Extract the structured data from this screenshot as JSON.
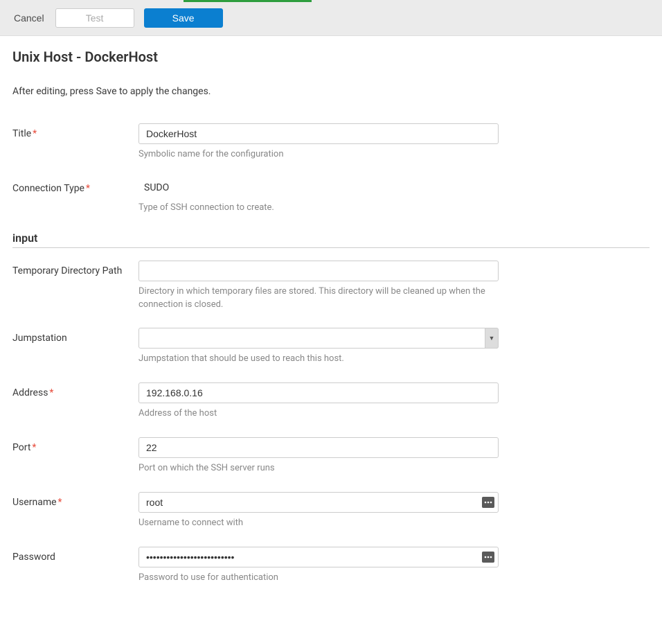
{
  "toolbar": {
    "cancel_label": "Cancel",
    "test_label": "Test",
    "save_label": "Save"
  },
  "page": {
    "title": "Unix Host - DockerHost",
    "subtitle": "After editing, press Save to apply the changes."
  },
  "fields": {
    "title": {
      "label": "Title",
      "value": "DockerHost",
      "help": "Symbolic name for the configuration"
    },
    "connection_type": {
      "label": "Connection Type",
      "value": "SUDO",
      "help": "Type of SSH connection to create."
    },
    "temp_dir": {
      "label": "Temporary Directory Path",
      "value": "",
      "help": "Directory in which temporary files are stored. This directory will be cleaned up when the connection is closed."
    },
    "jumpstation": {
      "label": "Jumpstation",
      "value": "",
      "help": "Jumpstation that should be used to reach this host."
    },
    "address": {
      "label": "Address",
      "value": "192.168.0.16",
      "help": "Address of the host"
    },
    "port": {
      "label": "Port",
      "value": "22",
      "help": "Port on which the SSH server runs"
    },
    "username": {
      "label": "Username",
      "value": "root",
      "help": "Username to connect with"
    },
    "password": {
      "label": "Password",
      "value": "••••••••••••••••••••••••••",
      "help": "Password to use for authentication"
    }
  },
  "sections": {
    "input": "input"
  }
}
